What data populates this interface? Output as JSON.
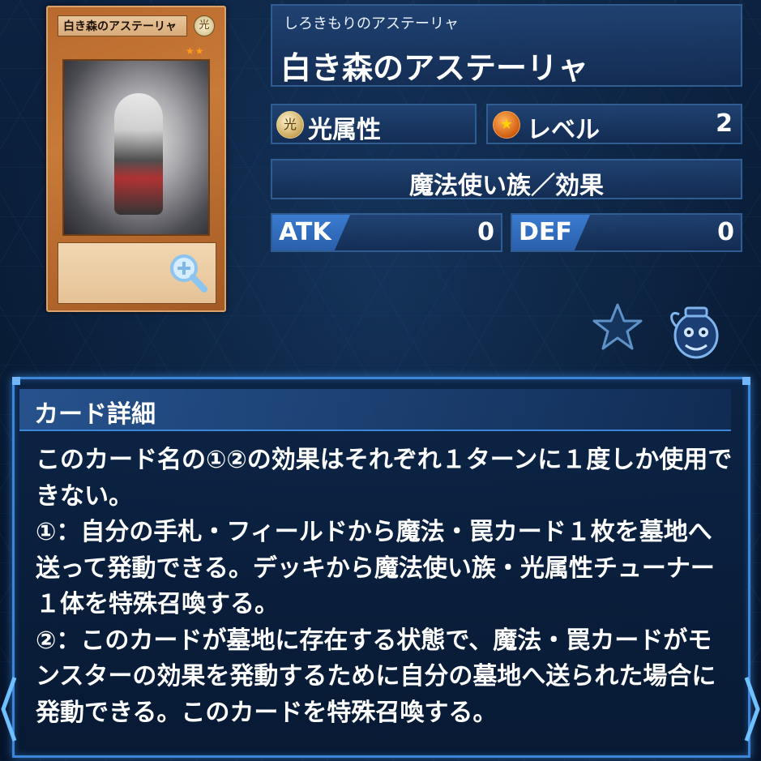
{
  "card": {
    "thumbnail_name": "白き森のアステーリャ",
    "thumbnail_attr_glyph": "光",
    "thumbnail_stars": "★★"
  },
  "header": {
    "kana": "しろきもりのアステーリャ",
    "name": "白き森のアステーリャ"
  },
  "attribute": {
    "icon_glyph": "光",
    "label": "光属性"
  },
  "level": {
    "label": "レベル",
    "value": "2"
  },
  "type": {
    "label": "魔法使い族／効果"
  },
  "stats": {
    "atk_label": "ATK",
    "atk_value": "0",
    "def_label": "DEF",
    "def_value": "0"
  },
  "detail": {
    "title": "カード詳細",
    "body": "このカード名の①②の効果はそれぞれ１ターンに１度しか使用できない。\n①：自分の手札・フィールドから魔法・罠カード１枚を墓地へ送って発動できる。デッキから魔法使い族・光属性チューナー１体を特殊召喚する。\n②：このカードが墓地に存在する状態で、魔法・罠カードがモンスターの効果を発動するために自分の墓地へ送られた場合に発動できる。このカードを特殊召喚する。"
  },
  "icons": {
    "zoom": "zoom-icon",
    "favorite": "star-icon",
    "deck": "deck-jar-icon",
    "prev": "chevron-left-icon",
    "next": "chevron-right-icon"
  },
  "colors": {
    "accent": "#3b86d8",
    "panel": "#1e3f70",
    "stat_label": "#3a7bd0",
    "text": "#ffffff"
  }
}
